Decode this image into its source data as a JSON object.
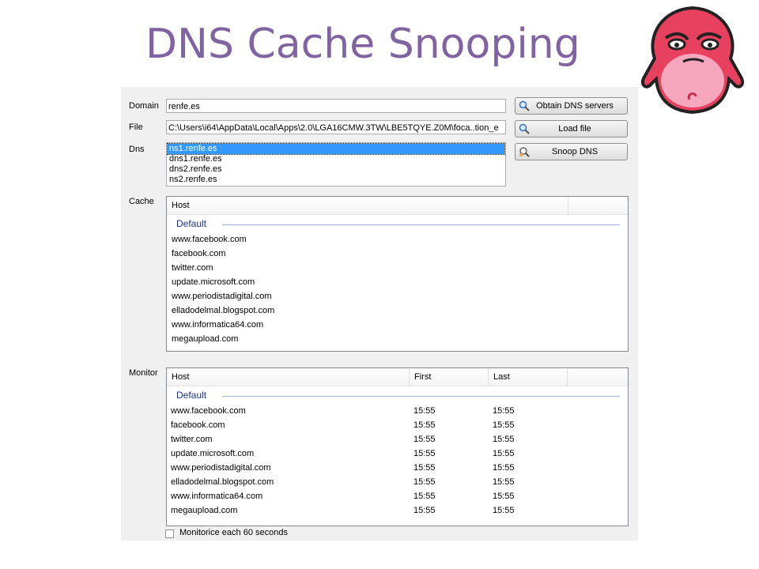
{
  "slide": {
    "title": "DNS Cache Snooping"
  },
  "form": {
    "domain_label": "Domain",
    "domain_value": "renfe.es",
    "file_label": "File",
    "file_value": "C:\\Users\\i64\\AppData\\Local\\Apps\\2.0\\LGA16CMW.3TW\\LBE5TQYE.Z0M\\foca..tion_e",
    "dns_label": "Dns",
    "dns_items": [
      "ns1.renfe.es",
      "dns1.renfe.es",
      "dns2.renfe.es",
      "ns2.renfe.es"
    ],
    "cache_label": "Cache",
    "monitor_label": "Monitor"
  },
  "buttons": {
    "obtain": "Obtain DNS servers",
    "load": "Load file",
    "snoop": "Snoop DNS"
  },
  "cache": {
    "column_host": "Host",
    "group": "Default",
    "hosts": [
      "www.facebook.com",
      "facebook.com",
      "twitter.com",
      "update.microsoft.com",
      "www.periodistadigital.com",
      "elladodelmal.blogspot.com",
      "www.informatica64.com",
      "megaupload.com"
    ]
  },
  "monitor": {
    "columns": [
      "Host",
      "First",
      "Last"
    ],
    "group": "Default",
    "rows": [
      [
        "www.facebook.com",
        "15:55",
        "15:55"
      ],
      [
        "facebook.com",
        "15:55",
        "15:55"
      ],
      [
        "twitter.com",
        "15:55",
        "15:55"
      ],
      [
        "update.microsoft.com",
        "15:55",
        "15:55"
      ],
      [
        "www.periodistadigital.com",
        "15:55",
        "15:55"
      ],
      [
        "elladodelmal.blogspot.com",
        "15:55",
        "15:55"
      ],
      [
        "www.informatica64.com",
        "15:55",
        "15:55"
      ],
      [
        "megaupload.com",
        "15:55",
        "15:55"
      ]
    ]
  },
  "monitor_option": {
    "label": "Monitorice each 60 seconds",
    "checked": false
  },
  "icons": {
    "search": "magnifier-icon",
    "snoop": "magnifier-hand-icon",
    "mascot": "pink-monster-mascot"
  }
}
